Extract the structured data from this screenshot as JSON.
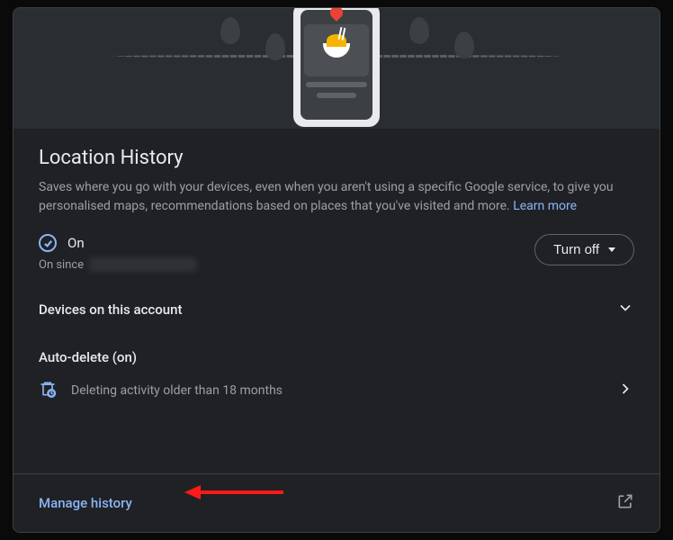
{
  "header": {
    "title": "Location History",
    "description": "Saves where you go with your devices, even when you aren't using a specific Google service, to give you personalised maps, recommendations based on places that you've visited and more. ",
    "learn_more": "Learn more"
  },
  "status": {
    "state_label": "On",
    "since_prefix": "On since",
    "turn_off_label": "Turn off"
  },
  "devices": {
    "title": "Devices on this account"
  },
  "auto_delete": {
    "title": "Auto-delete (on)",
    "detail": "Deleting activity older than 18 months"
  },
  "footer": {
    "manage_label": "Manage history"
  }
}
